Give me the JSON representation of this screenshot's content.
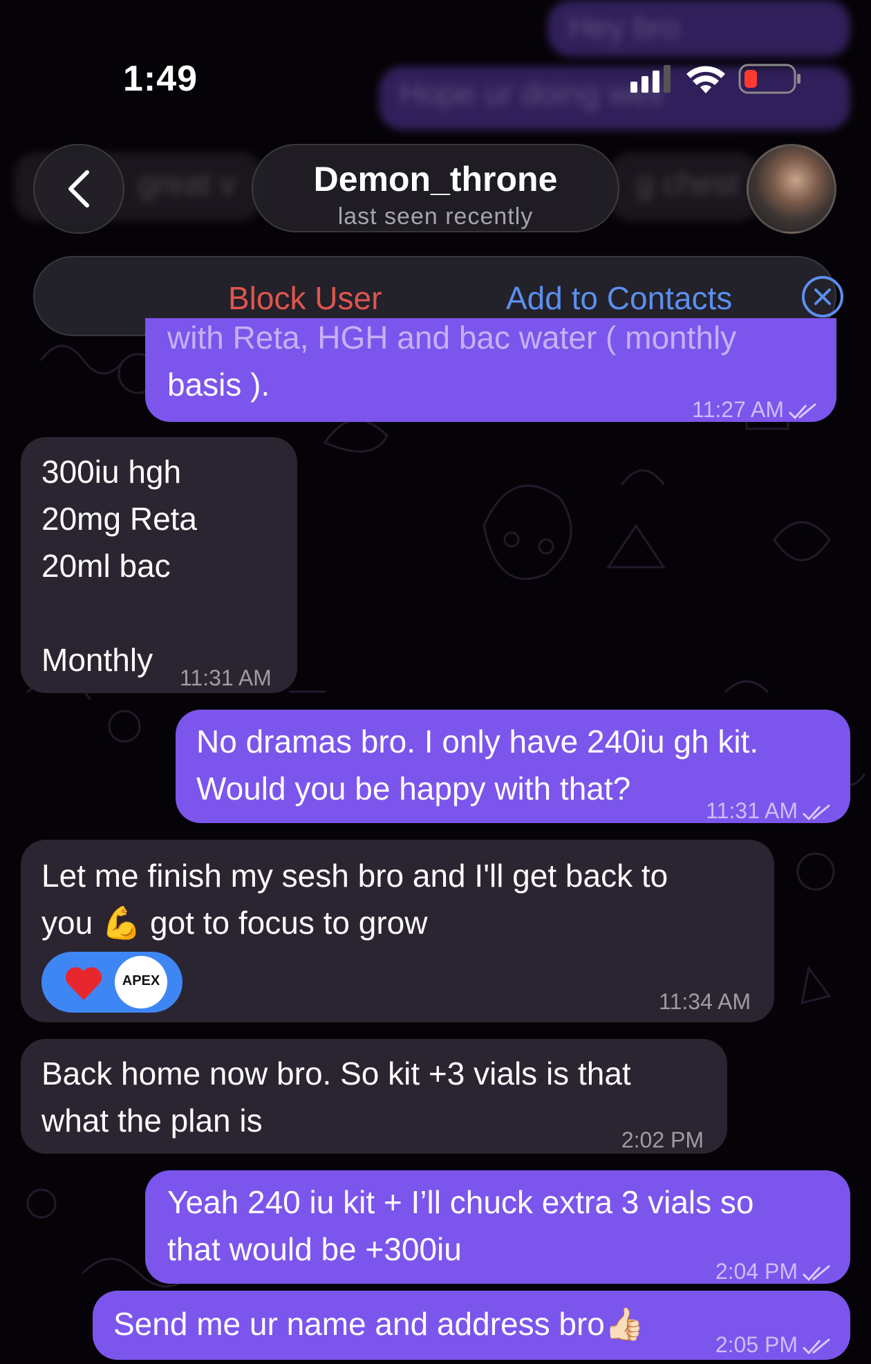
{
  "status_bar": {
    "time": "1:49"
  },
  "header": {
    "name": "Demon_throne",
    "status": "last seen recently",
    "block_label": "Block User",
    "add_label": "Add to Contacts"
  },
  "ghost_messages": {
    "m1": "Hey bro",
    "m2": "Hope ur doing well",
    "m3": "great v",
    "m4": "g chest"
  },
  "messages": [
    {
      "lines": [
        "with Reta, HGH and bac water ( monthly",
        "basis )."
      ],
      "time": "11:27 AM"
    },
    {
      "lines": [
        "300iu hgh",
        "20mg Reta",
        "20ml bac",
        "",
        "Monthly"
      ],
      "time": "11:31 AM"
    },
    {
      "lines": [
        "No dramas bro. I only have 240iu gh kit.",
        "Would you be happy with that?"
      ],
      "time": "11:31 AM"
    },
    {
      "lines": [
        "Let me finish my sesh bro and I'll get back to",
        "you 💪 got to focus to grow"
      ],
      "time": "11:34 AM",
      "reaction_badge": "APEX"
    },
    {
      "lines": [
        "Back home now bro. So kit +3 vials is that",
        "what the plan is"
      ],
      "time": "2:02 PM"
    },
    {
      "lines": [
        "Yeah 240 iu kit + I’ll chuck extra 3 vials so",
        "that would be +300iu"
      ],
      "time": "2:04 PM"
    },
    {
      "lines": [
        "Send me ur name and address bro👍🏻"
      ],
      "time": "2:05 PM"
    }
  ],
  "colors": {
    "outgoing": "#7c55ec",
    "incoming": "#2a2530",
    "block": "#e0554f",
    "link": "#5b8ff0",
    "reaction": "#3f86f5"
  }
}
